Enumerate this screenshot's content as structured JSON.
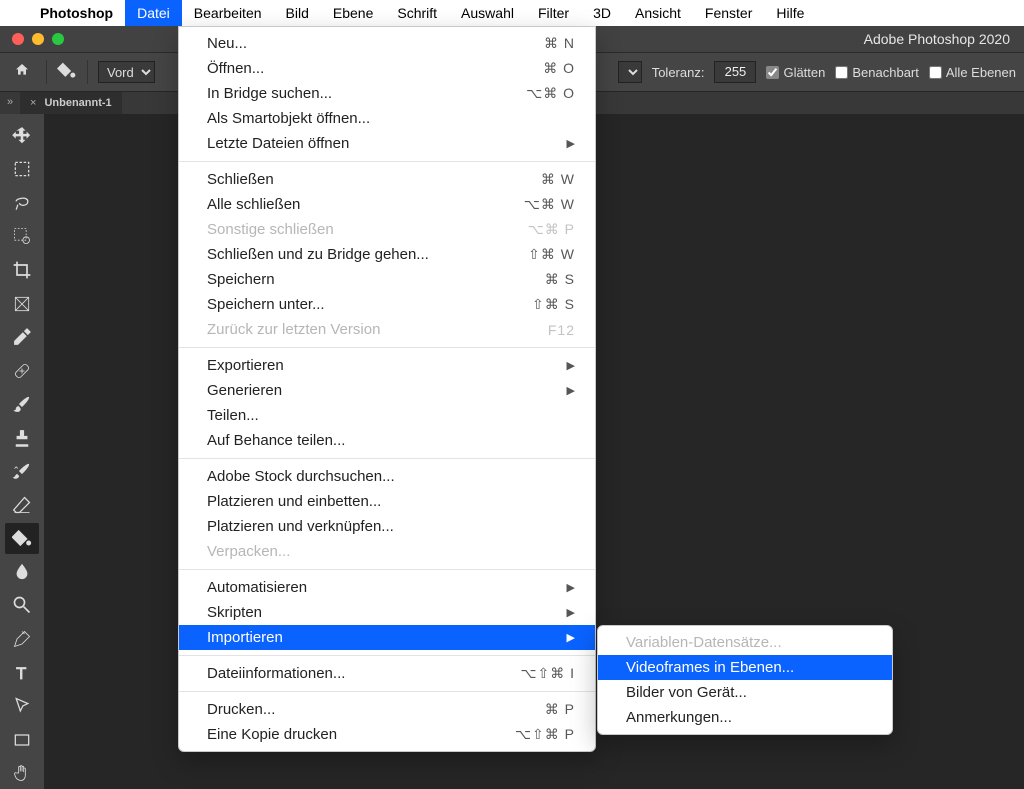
{
  "menubar": {
    "app_name": "Photoshop",
    "items": [
      "Datei",
      "Bearbeiten",
      "Bild",
      "Ebene",
      "Schrift",
      "Auswahl",
      "Filter",
      "3D",
      "Ansicht",
      "Fenster",
      "Hilfe"
    ],
    "active_index": 0
  },
  "window": {
    "title": "Adobe Photoshop 2020"
  },
  "optbar": {
    "foreground_label": "Vord",
    "tolerance_label": "Toleranz:",
    "tolerance_value": "255",
    "glatten": "Glätten",
    "benachbart": "Benachbart",
    "alle_ebenen": "Alle Ebenen"
  },
  "tab": {
    "name": "Unbenannt-1"
  },
  "menu": {
    "groups": [
      [
        {
          "label": "Neu...",
          "shortcut": "⌘ N"
        },
        {
          "label": "Öffnen...",
          "shortcut": "⌘ O"
        },
        {
          "label": "In Bridge suchen...",
          "shortcut": "⌥⌘ O"
        },
        {
          "label": "Als Smartobjekt öffnen..."
        },
        {
          "label": "Letzte Dateien öffnen",
          "submenu": true
        }
      ],
      [
        {
          "label": "Schließen",
          "shortcut": "⌘ W"
        },
        {
          "label": "Alle schließen",
          "shortcut": "⌥⌘ W"
        },
        {
          "label": "Sonstige schließen",
          "shortcut": "⌥⌘ P",
          "disabled": true
        },
        {
          "label": "Schließen und zu Bridge gehen...",
          "shortcut": "⇧⌘ W"
        },
        {
          "label": "Speichern",
          "shortcut": "⌘ S"
        },
        {
          "label": "Speichern unter...",
          "shortcut": "⇧⌘ S"
        },
        {
          "label": "Zurück zur letzten Version",
          "shortcut": "F12",
          "disabled": true
        }
      ],
      [
        {
          "label": "Exportieren",
          "submenu": true
        },
        {
          "label": "Generieren",
          "submenu": true
        },
        {
          "label": "Teilen..."
        },
        {
          "label": "Auf Behance teilen..."
        }
      ],
      [
        {
          "label": "Adobe Stock durchsuchen..."
        },
        {
          "label": "Platzieren und einbetten..."
        },
        {
          "label": "Platzieren und verknüpfen..."
        },
        {
          "label": "Verpacken...",
          "disabled": true
        }
      ],
      [
        {
          "label": "Automatisieren",
          "submenu": true
        },
        {
          "label": "Skripten",
          "submenu": true
        },
        {
          "label": "Importieren",
          "submenu": true,
          "highlight": true
        }
      ],
      [
        {
          "label": "Dateiinformationen...",
          "shortcut": "⌥⇧⌘ I"
        }
      ],
      [
        {
          "label": "Drucken...",
          "shortcut": "⌘ P"
        },
        {
          "label": "Eine Kopie drucken",
          "shortcut": "⌥⇧⌘ P"
        }
      ]
    ]
  },
  "submenu": {
    "items": [
      {
        "label": "Variablen-Datensätze...",
        "disabled": true
      },
      {
        "label": "Videoframes in Ebenen...",
        "highlight": true
      },
      {
        "label": "Bilder von Gerät..."
      },
      {
        "label": "Anmerkungen..."
      }
    ]
  }
}
